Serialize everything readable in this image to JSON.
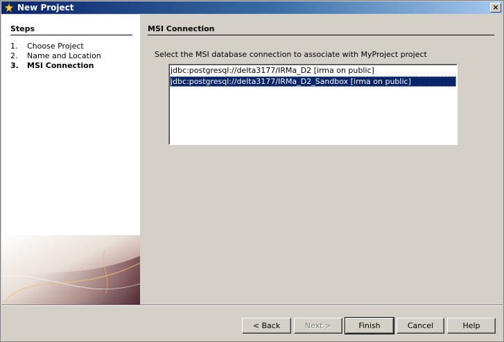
{
  "window": {
    "title": "New Project"
  },
  "steps": {
    "heading": "Steps",
    "items": [
      {
        "num": "1.",
        "label": "Choose Project"
      },
      {
        "num": "2.",
        "label": "Name and Location"
      },
      {
        "num": "3.",
        "label": "MSI Connection"
      }
    ],
    "current_index": 2
  },
  "main": {
    "heading": "MSI Connection",
    "instruction": "Select the MSI database connection to associate with MyProject project",
    "connections": [
      {
        "label": "jdbc:postgresql://delta3177/IRMa_D2 [irma on public]",
        "selected": false
      },
      {
        "label": "jdbc:postgresql://delta3177/IRMa_D2_Sandbox [irma on public]",
        "selected": true
      }
    ]
  },
  "buttons": {
    "back": "< Back",
    "next": "Next >",
    "finish": "Finish",
    "cancel": "Cancel",
    "help": "Help"
  },
  "colors": {
    "titlebar_start": "#0a246a",
    "titlebar_end": "#a6caf0",
    "selection": "#0a246a",
    "dialog_bg": "#d4d0c8"
  },
  "icons": {
    "title": "new-project-icon",
    "close": "close-icon"
  }
}
